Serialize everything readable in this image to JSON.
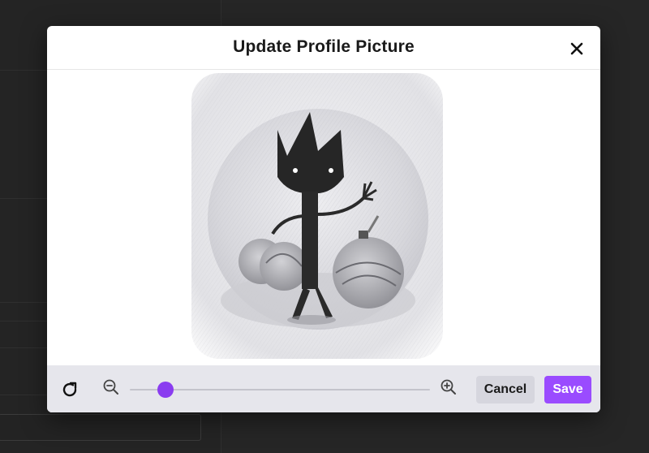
{
  "dialog": {
    "title": "Update Profile Picture"
  },
  "icons": {
    "close": "close-icon",
    "rotate": "rotate-icon",
    "zoom_out": "zoom-out-icon",
    "zoom_in": "zoom-in-icon"
  },
  "zoom": {
    "level_fraction": 0.12
  },
  "actions": {
    "cancel_label": "Cancel",
    "save_label": "Save"
  },
  "colors": {
    "accent": "#9a4bff",
    "slider_thumb": "#8a3cf0",
    "toolbar_bg": "#e6e6ec",
    "backdrop": "#262626"
  }
}
